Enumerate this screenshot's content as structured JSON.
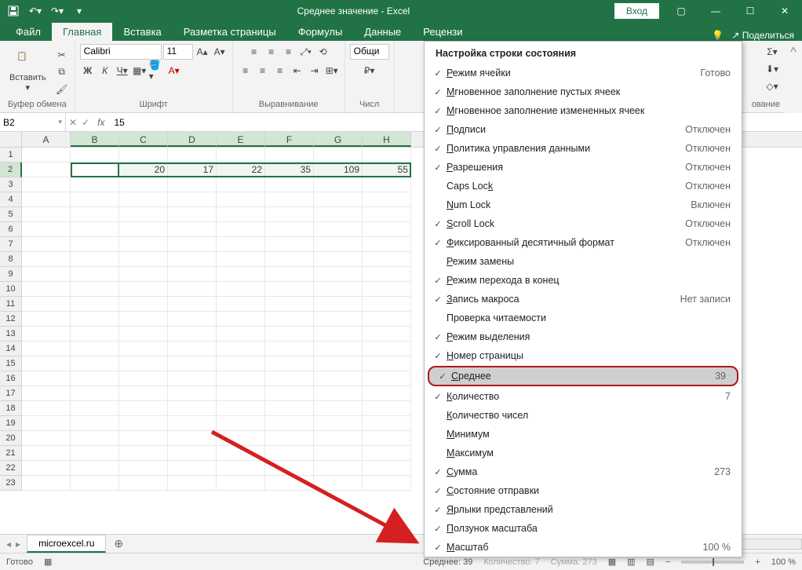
{
  "titlebar": {
    "title": "Среднее значение  -  Excel",
    "login": "Вход"
  },
  "tabs": {
    "file": "Файл",
    "home": "Главная",
    "insert": "Вставка",
    "layout": "Разметка страницы",
    "formulas": "Формулы",
    "data": "Данные",
    "review": "Рецензи",
    "share": "Поделиться"
  },
  "ribbon": {
    "paste": "Вставить",
    "clipboard": "Буфер обмена",
    "font_name": "Calibri",
    "font_size": "11",
    "font_group": "Шрифт",
    "align_group": "Выравнивание",
    "number_group": "Числ",
    "number_format": "Общи",
    "edit_group": "ование"
  },
  "formula": {
    "namebox": "B2",
    "value": "15"
  },
  "columns": [
    "A",
    "B",
    "C",
    "D",
    "E",
    "F",
    "G",
    "H"
  ],
  "rows": [
    "1",
    "2",
    "3",
    "4",
    "5",
    "6",
    "7",
    "8",
    "9",
    "10",
    "11",
    "12",
    "13",
    "14",
    "15",
    "16",
    "17",
    "18",
    "19",
    "20",
    "21",
    "22",
    "23"
  ],
  "data_row": {
    "B": "15",
    "C": "20",
    "D": "17",
    "E": "22",
    "F": "35",
    "G": "109",
    "H": "55"
  },
  "sheet": {
    "name": "microexcel.ru"
  },
  "status": {
    "ready": "Готово",
    "avg_label": "Среднее:",
    "avg_val": "39",
    "count_label": "Количество:",
    "count_val": "7",
    "sum_label": "Сумма:",
    "sum_val": "273",
    "zoom": "100 %"
  },
  "ctx": {
    "title": "Настройка строки состояния",
    "items": [
      {
        "check": true,
        "label": "Режим ячейки",
        "u": "Р",
        "status": "Готово"
      },
      {
        "check": true,
        "label": "Мгновенное заполнение пустых ячеек",
        "u": "М"
      },
      {
        "check": true,
        "label": "Мгновенное заполнение измененных ячеек",
        "u": "М"
      },
      {
        "check": true,
        "label": "Подписи",
        "u": "П",
        "status": "Отключен"
      },
      {
        "check": true,
        "label": "Политика управления данными",
        "u": "П",
        "status": "Отключен"
      },
      {
        "check": true,
        "label": "Разрешения",
        "u": "Р",
        "status": "Отключен"
      },
      {
        "check": false,
        "label": "Caps Lock",
        "u": "k",
        "status": "Отключен"
      },
      {
        "check": false,
        "label": "Num Lock",
        "u": "N",
        "status": "Включен"
      },
      {
        "check": true,
        "label": "Scroll Lock",
        "u": "S",
        "status": "Отключен"
      },
      {
        "check": true,
        "label": "Фиксированный десятичный формат",
        "u": "Ф",
        "status": "Отключен"
      },
      {
        "check": false,
        "label": "Режим замены",
        "u": "Р"
      },
      {
        "check": true,
        "label": "Режим перехода в конец",
        "u": "Р"
      },
      {
        "check": true,
        "label": "Запись макроса",
        "u": "З",
        "status": "Нет записи"
      },
      {
        "check": false,
        "label": "Проверка читаемости"
      },
      {
        "check": true,
        "label": "Режим выделения",
        "u": "Р"
      },
      {
        "check": true,
        "label": "Номер страницы",
        "u": "Н"
      },
      {
        "check": true,
        "label": "Среднее",
        "u": "С",
        "status": "39",
        "hl": true
      },
      {
        "check": true,
        "label": "Количество",
        "u": "К",
        "status": "7"
      },
      {
        "check": false,
        "label": "Количество чисел",
        "u": "К"
      },
      {
        "check": false,
        "label": "Минимум",
        "u": "М"
      },
      {
        "check": false,
        "label": "Максимум",
        "u": "М"
      },
      {
        "check": true,
        "label": "Сумма",
        "u": "С",
        "status": "273"
      },
      {
        "check": true,
        "label": "Состояние отправки",
        "u": "С"
      },
      {
        "check": true,
        "label": "Ярлыки представлений",
        "u": "Я"
      },
      {
        "check": true,
        "label": "Ползунок масштаба",
        "u": "П"
      },
      {
        "check": true,
        "label": "Масштаб",
        "u": "М",
        "status": "100 %"
      }
    ]
  }
}
